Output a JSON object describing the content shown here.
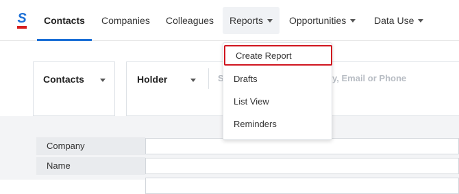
{
  "nav": {
    "logo_letter": "S",
    "items": [
      {
        "label": "Contacts",
        "active": true,
        "has_caret": false
      },
      {
        "label": "Companies",
        "active": false,
        "has_caret": false
      },
      {
        "label": "Colleagues",
        "active": false,
        "has_caret": false
      },
      {
        "label": "Reports",
        "active": false,
        "has_caret": true
      },
      {
        "label": "Opportunities",
        "active": false,
        "has_caret": true
      },
      {
        "label": "Data Use",
        "active": false,
        "has_caret": true
      }
    ]
  },
  "reports_menu": {
    "items": [
      "Create Report",
      "Drafts",
      "List View",
      "Reminders"
    ],
    "highlighted_index": 0
  },
  "filter": {
    "type_select": "Contacts",
    "holder_select": "Holder",
    "search_placeholder_left": "S",
    "search_placeholder_right": "y, Email or Phone"
  },
  "form": {
    "fields": [
      {
        "label": "Company",
        "value": ""
      },
      {
        "label": "Name",
        "value": ""
      }
    ]
  },
  "colors": {
    "brand_blue": "#1b6fd6",
    "brand_red": "#d71e1e",
    "highlight_red": "#d0141e"
  }
}
